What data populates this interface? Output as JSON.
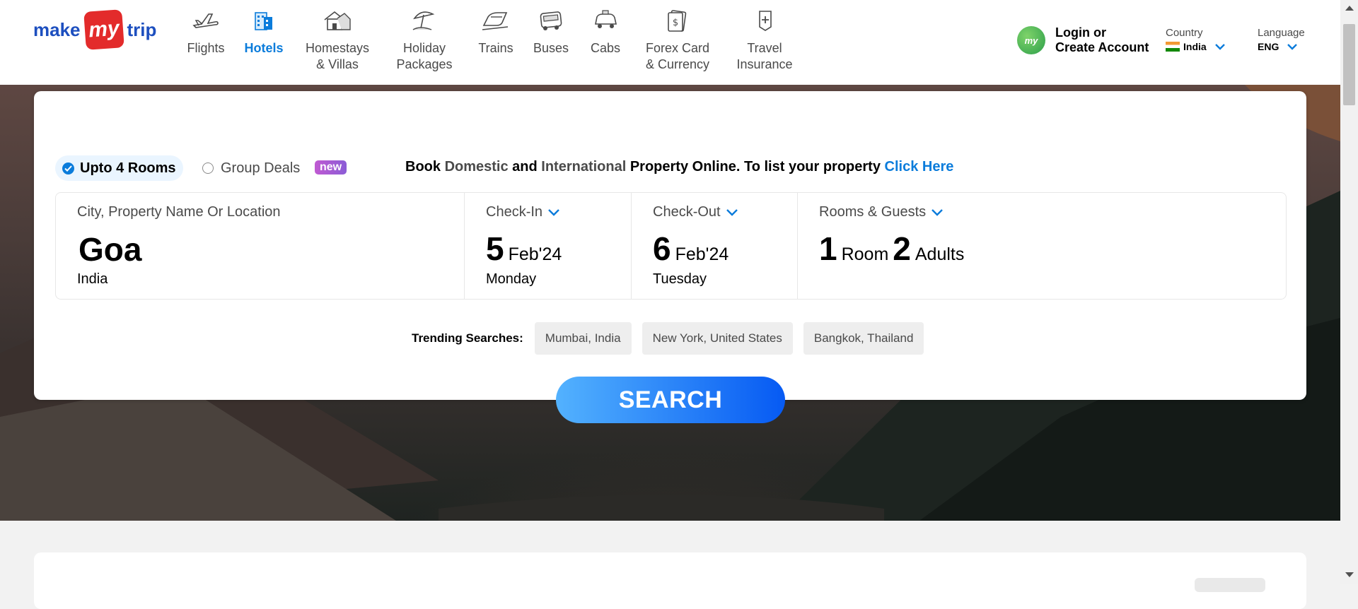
{
  "logo": {
    "part1": "make",
    "part2": "my",
    "part3": "trip"
  },
  "nav": [
    {
      "label": "Flights",
      "icon": "plane-icon",
      "active": false
    },
    {
      "label": "Hotels",
      "icon": "hotel-icon",
      "active": true
    },
    {
      "label": "Homestays\n& Villas",
      "icon": "homestay-icon",
      "active": false
    },
    {
      "label": "Holiday\nPackages",
      "icon": "beach-umbrella-icon",
      "active": false
    },
    {
      "label": "Trains",
      "icon": "train-icon",
      "active": false
    },
    {
      "label": "Buses",
      "icon": "bus-icon",
      "active": false
    },
    {
      "label": "Cabs",
      "icon": "cab-icon",
      "active": false
    },
    {
      "label": "Forex Card\n& Currency",
      "icon": "forex-card-icon",
      "active": false
    },
    {
      "label": "Travel\nInsurance",
      "icon": "insurance-shield-icon",
      "active": false
    }
  ],
  "account": {
    "avatar_text": "my",
    "line1": "Login or",
    "line2": "Create Account"
  },
  "country": {
    "label": "Country",
    "value": "India"
  },
  "language": {
    "label": "Language",
    "value": "ENG"
  },
  "booking": {
    "option1": "Upto 4 Rooms",
    "option2": "Group Deals",
    "new_badge": "new",
    "promo": {
      "p1": "Book ",
      "domestic": "Domestic",
      "p2": " and ",
      "international": "International",
      "p3": " Property Online. To list your property ",
      "link": "Click Here"
    }
  },
  "fields": {
    "city": {
      "label": "City, Property Name Or Location",
      "value": "Goa",
      "sub": "India"
    },
    "checkin": {
      "label": "Check-In",
      "day": "5",
      "month": "Feb'24",
      "weekday": "Monday"
    },
    "checkout": {
      "label": "Check-Out",
      "day": "6",
      "month": "Feb'24",
      "weekday": "Tuesday"
    },
    "rooms": {
      "label": "Rooms & Guests",
      "rooms_num": "1",
      "rooms_word": "Room",
      "adults_num": "2",
      "adults_word": "Adults"
    }
  },
  "trending": {
    "label": "Trending Searches:",
    "items": [
      "Mumbai, India",
      "New York, United States",
      "Bangkok, Thailand"
    ]
  },
  "search_button": "SEARCH",
  "colors": {
    "brand_blue": "#0b7cdb",
    "logo_red": "#e32b2b",
    "button_start": "#53b2fe",
    "button_end": "#065af3"
  }
}
